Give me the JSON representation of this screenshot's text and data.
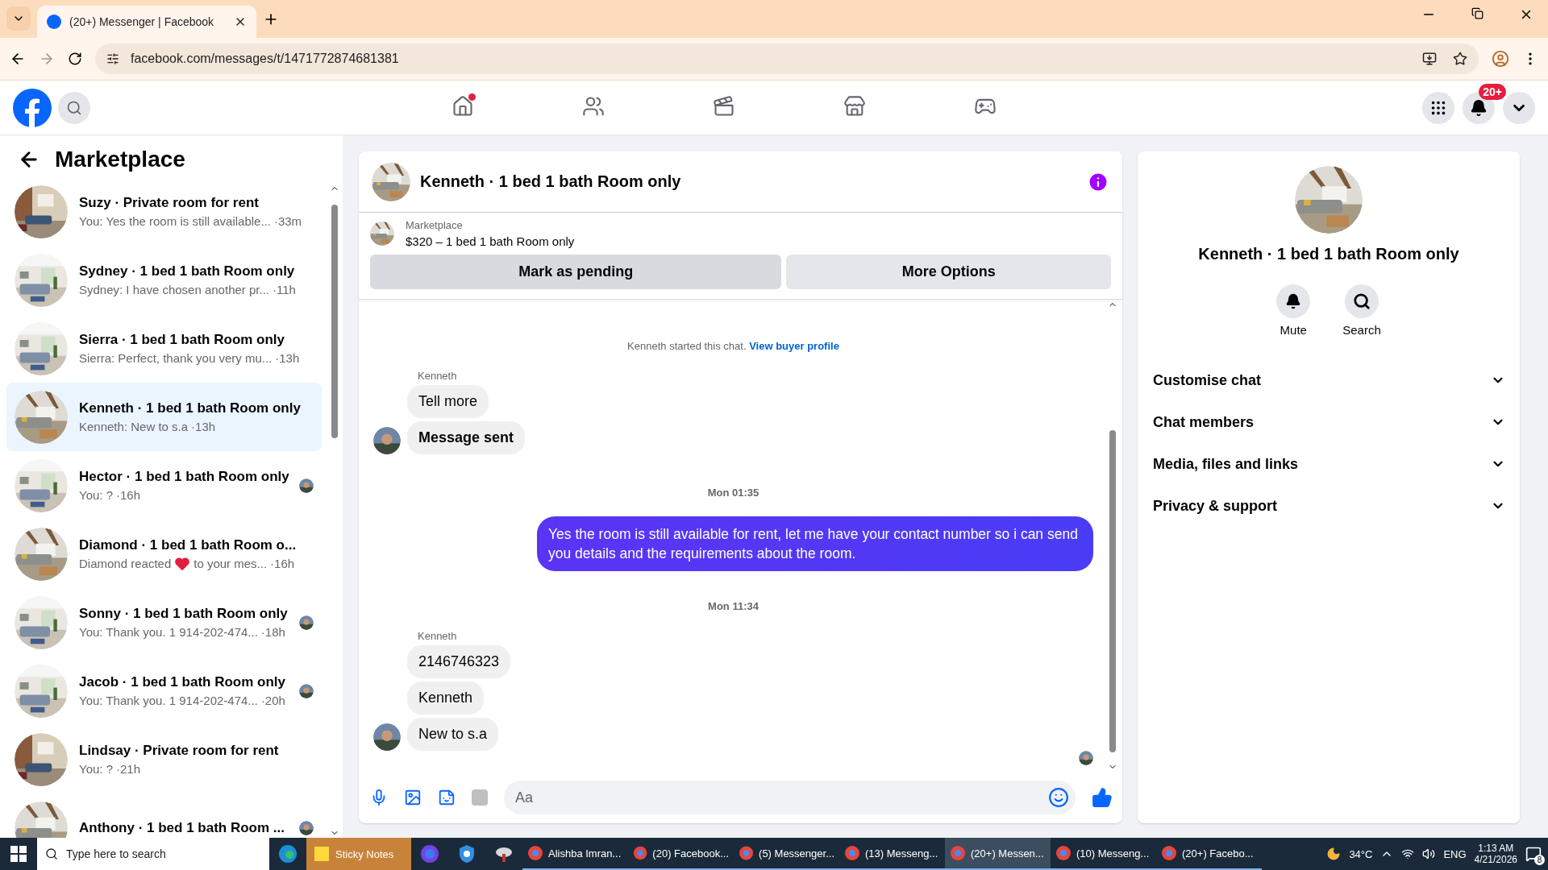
{
  "browser": {
    "tab_title": "(20+) Messenger | Facebook",
    "url": "facebook.com/messages/t/1471772874681381"
  },
  "topnav": {
    "items": [
      {
        "kind": "home",
        "selected": false,
        "dot": true
      },
      {
        "kind": "friends",
        "selected": false,
        "dot": false
      },
      {
        "kind": "video",
        "selected": false,
        "dot": false
      },
      {
        "kind": "marketplace",
        "selected": false,
        "dot": false
      },
      {
        "kind": "gaming",
        "selected": false,
        "dot": false
      }
    ],
    "notification_badge": "20+"
  },
  "sidebar": {
    "title": "Marketplace",
    "items": [
      {
        "title": "Suzy · Private room for rent",
        "preview": "You: Yes the room is still available...",
        "time": "·33m",
        "selected": false,
        "seen_avatar": false
      },
      {
        "title": "Sydney · 1 bed 1 bath Room only",
        "preview": "Sydney: I have chosen another pr...",
        "time": "·11h",
        "selected": false,
        "seen_avatar": false
      },
      {
        "title": "Sierra · 1 bed 1 bath Room only",
        "preview": "Sierra: Perfect, thank you very mu...",
        "time": "·13h",
        "selected": false,
        "seen_avatar": false
      },
      {
        "title": "Kenneth · 1 bed 1 bath Room only",
        "preview": "Kenneth: New to s.a",
        "time": "·13h",
        "selected": true,
        "seen_avatar": false
      },
      {
        "title": "Hector · 1 bed 1 bath Room only",
        "preview": "You: ?",
        "time": "·16h",
        "selected": false,
        "seen_avatar": true
      },
      {
        "title": "Diamond · 1 bed 1 bath Room o...",
        "preview": "Diamond reacted",
        "preview_after": "to your mes...",
        "time": "·16h",
        "selected": false,
        "seen_avatar": false
      },
      {
        "title": "Sonny · 1 bed 1 bath Room only",
        "preview": "You: Thank you. 1 914-202-474...",
        "time": "·18h",
        "selected": false,
        "seen_avatar": true
      },
      {
        "title": "Jacob · 1 bed 1 bath Room only",
        "preview": "You: Thank you. 1 914-202-474...",
        "time": "·20h",
        "selected": false,
        "seen_avatar": true
      },
      {
        "title": "Lindsay · Private room for rent",
        "preview": "You: ?",
        "time": "·21h",
        "selected": false,
        "seen_avatar": false
      },
      {
        "title": "Anthony · 1 bed 1 bath Room ...",
        "selected": false,
        "seen_avatar": true
      }
    ]
  },
  "chat": {
    "title": "Kenneth · 1 bed 1 bath Room only",
    "listing": {
      "source": "Marketplace",
      "summary": "$320 – 1 bed 1 bath Room only"
    },
    "actions": [
      {
        "label": "Mark as pending",
        "kind": "primary"
      },
      {
        "label": "More Options",
        "kind": "secondary"
      }
    ],
    "messages": [
      {
        "kind": "system",
        "text": "Kenneth started this chat.",
        "link": "View buyer profile"
      },
      {
        "kind": "incoming",
        "sender": "Kenneth",
        "bubbles": [
          {
            "text": "Tell more",
            "bold": false
          },
          {
            "text": "Message sent",
            "bold": true
          }
        ]
      },
      {
        "kind": "timestamp",
        "text": "Mon 01:35"
      },
      {
        "kind": "outgoing",
        "text": "Yes the room is still available for rent, let me have your contact number so i can send you details and the requirements about the room."
      },
      {
        "kind": "timestamp",
        "text": "Mon 11:34"
      },
      {
        "kind": "incoming",
        "sender": "Kenneth",
        "bubbles": [
          {
            "text": "2146746323",
            "bold": false
          },
          {
            "text": "Kenneth",
            "bold": false
          },
          {
            "text": "New to s.a",
            "bold": false
          }
        ]
      }
    ],
    "composer": {
      "placeholder": "Aa"
    }
  },
  "details": {
    "title": "Kenneth · 1 bed 1 bath Room only",
    "actions": [
      {
        "kind": "mute",
        "label": "Mute"
      },
      {
        "kind": "search",
        "label": "Search"
      }
    ],
    "sections": [
      {
        "label": "Customise chat",
        "expanded": false
      },
      {
        "label": "Chat members",
        "expanded": false
      },
      {
        "label": "Media, files and links",
        "expanded": false
      },
      {
        "label": "Privacy & support",
        "expanded": false
      }
    ]
  },
  "taskbar": {
    "search_placeholder": "Type here to search",
    "apps": [
      {
        "kind": "edge"
      },
      {
        "kind": "sticky",
        "label": "Sticky Notes",
        "selected": false
      },
      {
        "kind": "firefox"
      },
      {
        "kind": "shield"
      },
      {
        "kind": "tool"
      }
    ],
    "windows": [
      {
        "label": "Alishba Imran...",
        "selected": false
      },
      {
        "label": "(20) Facebook...",
        "selected": false
      },
      {
        "label": "(5) Messenger...",
        "selected": false
      },
      {
        "label": "(13) Messeng...",
        "selected": false
      },
      {
        "label": "(20+) Messen...",
        "selected": true
      },
      {
        "label": "(10) Messeng...",
        "selected": false
      },
      {
        "label": "(20+) Facebo...",
        "selected": false
      }
    ],
    "temperature": "34°C",
    "language": "ENG",
    "time": "1:13 AM",
    "date": "4/21/2026",
    "notifications": "8"
  }
}
